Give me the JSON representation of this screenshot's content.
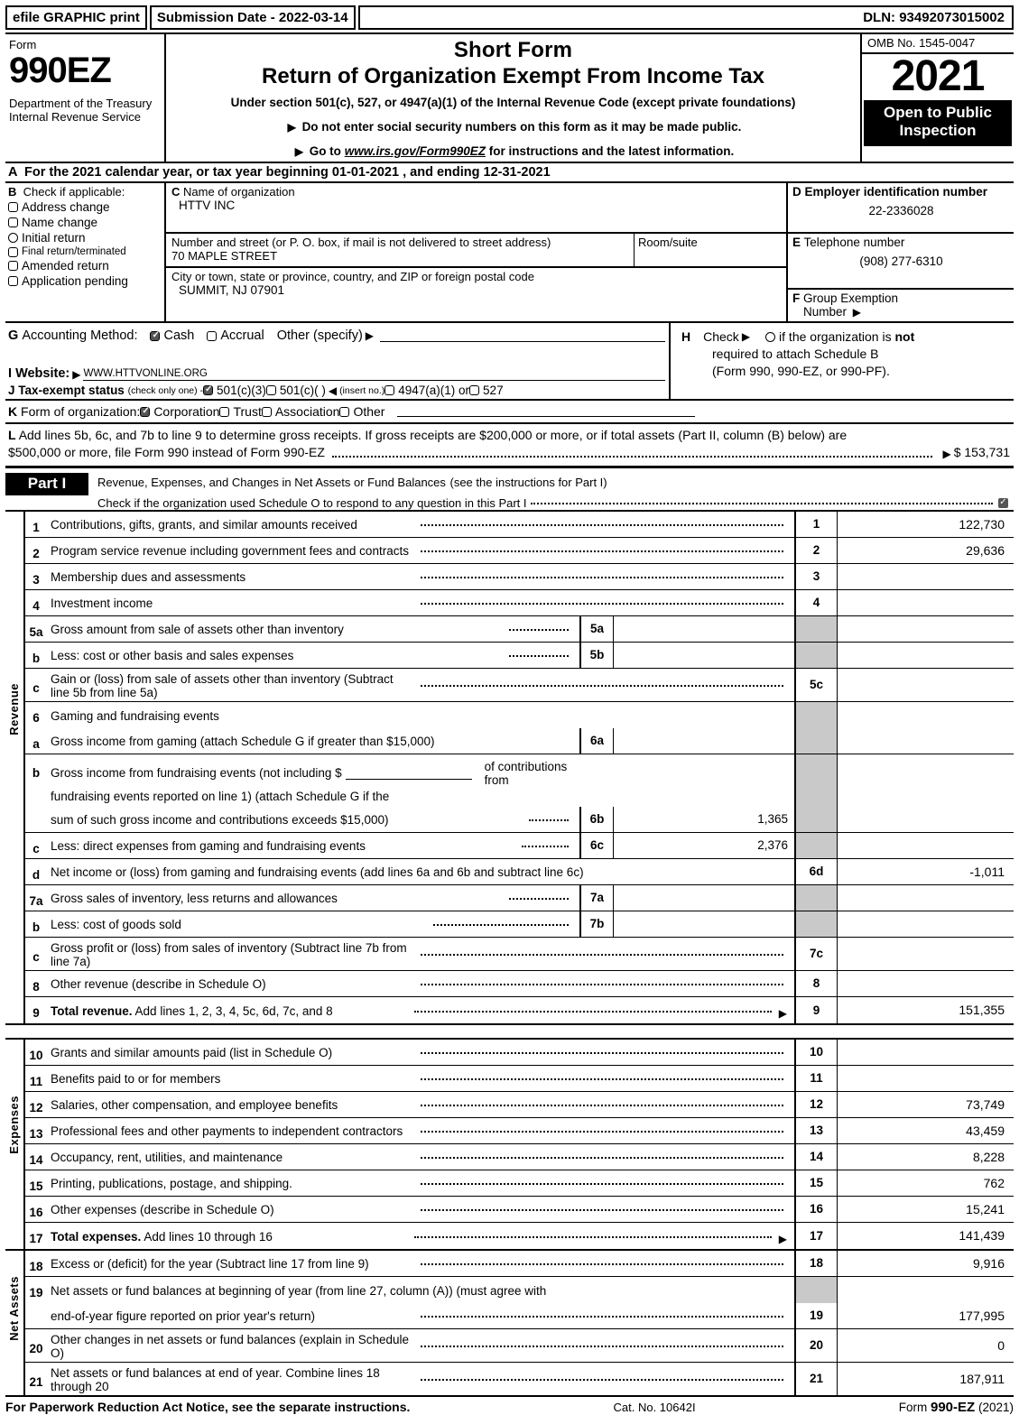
{
  "efile": {
    "print_label": "efile GRAPHIC print",
    "submission": "Submission Date - 2022-03-14",
    "dln": "DLN: 93492073015002"
  },
  "header": {
    "form_label": "Form",
    "form_number": "990EZ",
    "department": "Department of the Treasury Internal Revenue Service",
    "title_line1": "Short Form",
    "title_line2": "Return of Organization Exempt From Income Tax",
    "subtitle": "Under section 501(c), 527, or 4947(a)(1) of the Internal Revenue Code (except private foundations)",
    "note1": "Do not enter social security numbers on this form as it may be made public.",
    "note2_prefix": "Go to",
    "note2_url": "www.irs.gov/Form990EZ",
    "note2_suffix": "for instructions and the latest information.",
    "omb": "OMB No. 1545-0047",
    "tax_year": "2021",
    "open_to_public": "Open to Public Inspection"
  },
  "section_a": {
    "text": "For the 2021 calendar year, or tax year beginning 01-01-2021 , and ending 12-31-2021",
    "letter": "A"
  },
  "section_b": {
    "letter": "B",
    "heading": "Check if applicable:",
    "options": [
      {
        "label": "Address change",
        "checked": false,
        "shape": "square"
      },
      {
        "label": "Name change",
        "checked": false,
        "shape": "square"
      },
      {
        "label": "Initial return",
        "checked": false,
        "shape": "round"
      },
      {
        "label": "Final return/terminated",
        "checked": false,
        "shape": "square",
        "small": true
      },
      {
        "label": "Amended return",
        "checked": false,
        "shape": "square"
      },
      {
        "label": "Application pending",
        "checked": false,
        "shape": "square"
      }
    ]
  },
  "section_c": {
    "letter": "C",
    "name_label": "Name of organization",
    "name_value": "HTTV INC",
    "street_label": "Number and street (or P. O. box, if mail is not delivered to street address)",
    "street_value": "70 MAPLE STREET",
    "room_label": "Room/suite",
    "room_value": "",
    "city_label": "City or town, state or province, country, and ZIP or foreign postal code",
    "city_value": "SUMMIT, NJ  07901"
  },
  "section_d": {
    "letter": "D",
    "label": "Employer identification number",
    "value": "22-2336028"
  },
  "section_e": {
    "letter": "E",
    "label": "Telephone number",
    "value": "(908) 277-6310"
  },
  "section_f": {
    "letter": "F",
    "label_line1": "Group Exemption",
    "label_line2": "Number",
    "value": ""
  },
  "section_g": {
    "letter": "G",
    "label": "Accounting Method:",
    "cash": "Cash",
    "cash_checked": true,
    "accrual": "Accrual",
    "accrual_checked": false,
    "other": "Other (specify)",
    "other_value": ""
  },
  "section_h": {
    "letter": "H",
    "check_label": "Check",
    "text_a": "if the organization is",
    "text_not": "not",
    "line2": "required to attach Schedule B",
    "line3": "(Form 990, 990-EZ, or 990-PF).",
    "checked": false
  },
  "section_i": {
    "letter": "I",
    "label": "Website:",
    "value": "WWW.HTTVONLINE.ORG"
  },
  "section_j": {
    "letter": "J",
    "label": "Tax-exempt status",
    "note": "(check only one) -",
    "options": [
      {
        "label": "501(c)(3)",
        "checked": true
      },
      {
        "label": "501(c)(   )",
        "checked": false
      },
      {
        "label": "4947(a)(1) or",
        "checked": false
      },
      {
        "label": "527",
        "checked": false
      }
    ],
    "insert_no": "(insert no.)"
  },
  "section_k": {
    "letter": "K",
    "label": "Form of organization:",
    "options": [
      {
        "label": "Corporation",
        "checked": true
      },
      {
        "label": "Trust",
        "checked": false
      },
      {
        "label": "Association",
        "checked": false
      },
      {
        "label": "Other",
        "checked": false
      }
    ]
  },
  "section_l": {
    "letter": "L",
    "line1": "Add lines 5b, 6c, and 7b to line 9 to determine gross receipts. If gross receipts are $200,000 or more, or if total assets (Part II, column (B) below) are",
    "line2": "$500,000 or more, file Form 990 instead of Form 990-EZ",
    "amount": "$ 153,731"
  },
  "part1": {
    "label": "Part I",
    "title": "Revenue, Expenses, and Changes in Net Assets or Fund Balances",
    "title_note": "(see the instructions for Part I)",
    "check_text": "Check if the organization used Schedule O to respond to any question in this Part I",
    "checked": true
  },
  "side_labels": {
    "revenue": "Revenue",
    "expenses": "Expenses",
    "net_assets": "Net Assets"
  },
  "revenue_rows": [
    {
      "num": "1",
      "desc": "Contributions, gifts, grants, and similar amounts received",
      "leader": true,
      "lnbox": "1",
      "value": "122,730"
    },
    {
      "num": "2",
      "desc": "Program service revenue including government fees and contracts",
      "leader": true,
      "lnbox": "2",
      "value": "29,636"
    },
    {
      "num": "3",
      "desc": "Membership dues and assessments",
      "leader": true,
      "lnbox": "3",
      "value": ""
    },
    {
      "num": "4",
      "desc": "Investment income",
      "leader": true,
      "lnbox": "4",
      "value": ""
    },
    {
      "num": "5a",
      "desc": "Gross amount from sale of assets other than inventory",
      "leader": true,
      "sub_num": "5a",
      "sub_value": "",
      "lnbox": "",
      "shade": true,
      "value": ""
    },
    {
      "num": "b",
      "desc": "Less: cost or other basis and sales expenses",
      "leader": true,
      "sub_num": "5b",
      "sub_value": "",
      "lnbox": "",
      "shade": true,
      "value": ""
    },
    {
      "num": "c",
      "desc": "Gain or (loss) from sale of assets other than inventory (Subtract line 5b from line 5a)",
      "leader": true,
      "lnbox": "5c",
      "value": ""
    },
    {
      "num": "6",
      "desc": "Gaming and fundraising events",
      "leader": false,
      "lnbox": "",
      "shade": true,
      "value": ""
    },
    {
      "num": "a",
      "desc": "Gross income from gaming (attach Schedule G if greater than $15,000)",
      "leader": false,
      "sub_num": "6a",
      "sub_value": "",
      "lnbox": "",
      "shade": true,
      "value": ""
    },
    {
      "num": "b",
      "desc_l1": "Gross income from fundraising events (not including $",
      "desc_l1b": "of contributions from",
      "desc_l2": "fundraising events reported on line 1) (attach Schedule G if the",
      "desc_l3": "sum of such gross income and contributions exceeds $15,000)",
      "sub_num": "6b",
      "sub_value": "1,365",
      "lnbox": "",
      "shade": true,
      "value": "",
      "multiline": true
    },
    {
      "num": "c",
      "desc": "Less: direct expenses from gaming and fundraising events",
      "leader": true,
      "sub_num": "6c",
      "sub_value": "2,376",
      "lnbox": "",
      "shade": true,
      "value": ""
    },
    {
      "num": "d",
      "desc": "Net income or (loss) from gaming and fundraising events (add lines 6a and 6b and subtract line 6c)",
      "leader": false,
      "lnbox": "6d",
      "value": "-1,011"
    },
    {
      "num": "7a",
      "desc": "Gross sales of inventory, less returns and allowances",
      "leader": true,
      "sub_num": "7a",
      "sub_value": "",
      "lnbox": "",
      "shade": true,
      "value": ""
    },
    {
      "num": "b",
      "desc": "Less: cost of goods sold",
      "leader": true,
      "sub_num": "7b",
      "sub_value": "",
      "lnbox": "",
      "shade": true,
      "value": ""
    },
    {
      "num": "c",
      "desc": "Gross profit or (loss) from sales of inventory (Subtract line 7b from line 7a)",
      "leader": true,
      "lnbox": "7c",
      "value": ""
    },
    {
      "num": "8",
      "desc": "Other revenue (describe in Schedule O)",
      "leader": true,
      "lnbox": "8",
      "value": ""
    },
    {
      "num": "9",
      "desc_bold": "Total revenue.",
      "desc": "Add lines 1, 2, 3, 4, 5c, 6d, 7c, and 8",
      "leader": true,
      "arrow": true,
      "lnbox": "9",
      "value": "151,355"
    }
  ],
  "expense_rows": [
    {
      "num": "10",
      "desc": "Grants and similar amounts paid (list in Schedule O)",
      "leader": true,
      "lnbox": "10",
      "value": ""
    },
    {
      "num": "11",
      "desc": "Benefits paid to or for members",
      "leader": true,
      "lnbox": "11",
      "value": ""
    },
    {
      "num": "12",
      "desc": "Salaries, other compensation, and employee benefits",
      "leader": true,
      "lnbox": "12",
      "value": "73,749"
    },
    {
      "num": "13",
      "desc": "Professional fees and other payments to independent contractors",
      "leader": true,
      "lnbox": "13",
      "value": "43,459"
    },
    {
      "num": "14",
      "desc": "Occupancy, rent, utilities, and maintenance",
      "leader": true,
      "lnbox": "14",
      "value": "8,228"
    },
    {
      "num": "15",
      "desc": "Printing, publications, postage, and shipping.",
      "leader": true,
      "lnbox": "15",
      "value": "762"
    },
    {
      "num": "16",
      "desc": "Other expenses (describe in Schedule O)",
      "leader": true,
      "lnbox": "16",
      "value": "15,241"
    },
    {
      "num": "17",
      "desc_bold": "Total expenses.",
      "desc": "Add lines 10 through 16",
      "leader": true,
      "arrow": true,
      "lnbox": "17",
      "value": "141,439"
    }
  ],
  "netasset_rows": [
    {
      "num": "18",
      "desc": "Excess or (deficit) for the year (Subtract line 17 from line 9)",
      "leader": true,
      "lnbox": "18",
      "value": "9,916"
    },
    {
      "num": "19",
      "desc_l1": "Net assets or fund balances at beginning of year (from line 27, column (A)) (must agree with",
      "desc_l2": "end-of-year figure reported on prior year's return)",
      "leader": true,
      "lnbox": "19",
      "value": "177,995",
      "multiline": true,
      "shade_top": true
    },
    {
      "num": "20",
      "desc": "Other changes in net assets or fund balances (explain in Schedule O)",
      "leader": true,
      "lnbox": "20",
      "value": "0"
    },
    {
      "num": "21",
      "desc": "Net assets or fund balances at end of year. Combine lines 18 through 20",
      "leader": true,
      "lnbox": "21",
      "value": "187,911"
    }
  ],
  "footer": {
    "left": "For Paperwork Reduction Act Notice, see the separate instructions.",
    "center": "Cat. No. 10642I",
    "right_prefix": "Form",
    "right_bold": "990-EZ",
    "right_suffix": "(2021)"
  }
}
